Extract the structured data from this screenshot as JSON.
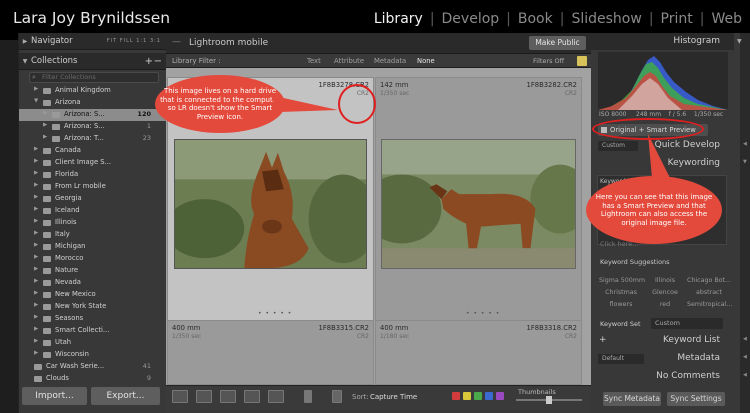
{
  "owner": "Lara Joy Brynildssen",
  "modules": [
    {
      "label": "Library",
      "active": true
    },
    {
      "label": "Develop",
      "active": false
    },
    {
      "label": "Book",
      "active": false
    },
    {
      "label": "Slideshow",
      "active": false
    },
    {
      "label": "Print",
      "active": false
    },
    {
      "label": "Web",
      "active": false
    }
  ],
  "navigator": {
    "title": "Navigator",
    "options": "FIT  FILL  1:1  3:1"
  },
  "collections": {
    "title": "Collections",
    "filter_placeholder": "Filter Collections",
    "items": [
      {
        "name": "Animal Kingdom",
        "count": ""
      },
      {
        "name": "Arizona",
        "count": ""
      },
      {
        "name": "Arizona: S...",
        "count": "120"
      },
      {
        "name": "Arizona: S...",
        "count": "1"
      },
      {
        "name": "Arizona: T...",
        "count": "23"
      },
      {
        "name": "Canada",
        "count": ""
      },
      {
        "name": "Client Image S...",
        "count": ""
      },
      {
        "name": "Florida",
        "count": ""
      },
      {
        "name": "From Lr mobile",
        "count": ""
      },
      {
        "name": "Georgia",
        "count": ""
      },
      {
        "name": "Iceland",
        "count": ""
      },
      {
        "name": "Illinois",
        "count": ""
      },
      {
        "name": "Italy",
        "count": ""
      },
      {
        "name": "Michigan",
        "count": ""
      },
      {
        "name": "Morocco",
        "count": ""
      },
      {
        "name": "Nature",
        "count": ""
      },
      {
        "name": "Nevada",
        "count": ""
      },
      {
        "name": "New Mexico",
        "count": ""
      },
      {
        "name": "New York State",
        "count": ""
      },
      {
        "name": "Seasons",
        "count": ""
      },
      {
        "name": "Smart Collecti...",
        "count": ""
      },
      {
        "name": "Utah",
        "count": ""
      },
      {
        "name": "Wisconsin",
        "count": ""
      },
      {
        "name": "Car Wash Serie...",
        "count": "41"
      },
      {
        "name": "Clouds",
        "count": "9"
      }
    ]
  },
  "import_label": "Import...",
  "export_label": "Export...",
  "collection_title": "Lightroom mobile",
  "make_public": "Make Public",
  "filter": {
    "label": "Library Filter :",
    "tabs": [
      {
        "label": "Text",
        "active": false
      },
      {
        "label": "Attribute",
        "active": false
      },
      {
        "label": "Metadata",
        "active": false
      },
      {
        "label": "None",
        "active": true
      }
    ],
    "status": "Filters Off"
  },
  "grid": {
    "cells": [
      {
        "dimensions": "",
        "filename": "1F8B3278.CR2",
        "shutter": "",
        "ext": "CR2",
        "selected": true
      },
      {
        "dimensions": "142 mm",
        "filename": "1F8B3282.CR2",
        "shutter": "1/350 sec",
        "ext": "CR2",
        "selected": false
      },
      {
        "dimensions": "400 mm",
        "filename": "1F8B3315.CR2",
        "shutter": "1/350 sec",
        "ext": "CR2",
        "selected": false
      },
      {
        "dimensions": "400 mm",
        "filename": "1F8B3318.CR2",
        "shutter": "1/180 sec",
        "ext": "CR2",
        "selected": false
      }
    ]
  },
  "histogram": {
    "title": "Histogram",
    "stats": {
      "iso": "ISO 8000",
      "focal": "248 mm",
      "aperture": "f / 5.6",
      "shutter": "1/350 sec"
    },
    "smart_preview": "Original + Smart Preview"
  },
  "right_panels": {
    "quick_develop": "Quick Develop",
    "quick_develop_preset": "Custom",
    "keywording": "Keywording",
    "keyword_tags": "Keyword Tags",
    "click_here": "Click here...",
    "keyword_suggestions": "Keyword Suggestions",
    "suggestions": [
      "Sigma 500mm",
      "Illinois",
      "Chicago Bot...",
      "Christmas",
      "Glencoe",
      "abstract",
      "flowers",
      "red",
      "Semitropical..."
    ],
    "keyword_set_label": "Keyword Set",
    "keyword_set_value": "Custom",
    "keyword_list": "Keyword List",
    "metadata": "Metadata",
    "metadata_preset": "Default",
    "comments": "No Comments",
    "sync_metadata": "Sync Metadata",
    "sync_settings": "Sync Settings"
  },
  "toolbar": {
    "sort_label": "Sort:",
    "sort_value": "Capture Time",
    "thumbnails_label": "Thumbnails",
    "flag_colors": [
      "#d23c3c",
      "#d8c83a",
      "#4aa84a",
      "#3a6ad0",
      "#9a4ac0"
    ]
  },
  "annotations": {
    "left_callout": "This image lives on a hard drive that is connected to the computer so LR doesn't show the Smart Preview icon.",
    "right_callout": "Here you can see that this image has a Smart Preview and that Lightroom can also access the original image file."
  }
}
